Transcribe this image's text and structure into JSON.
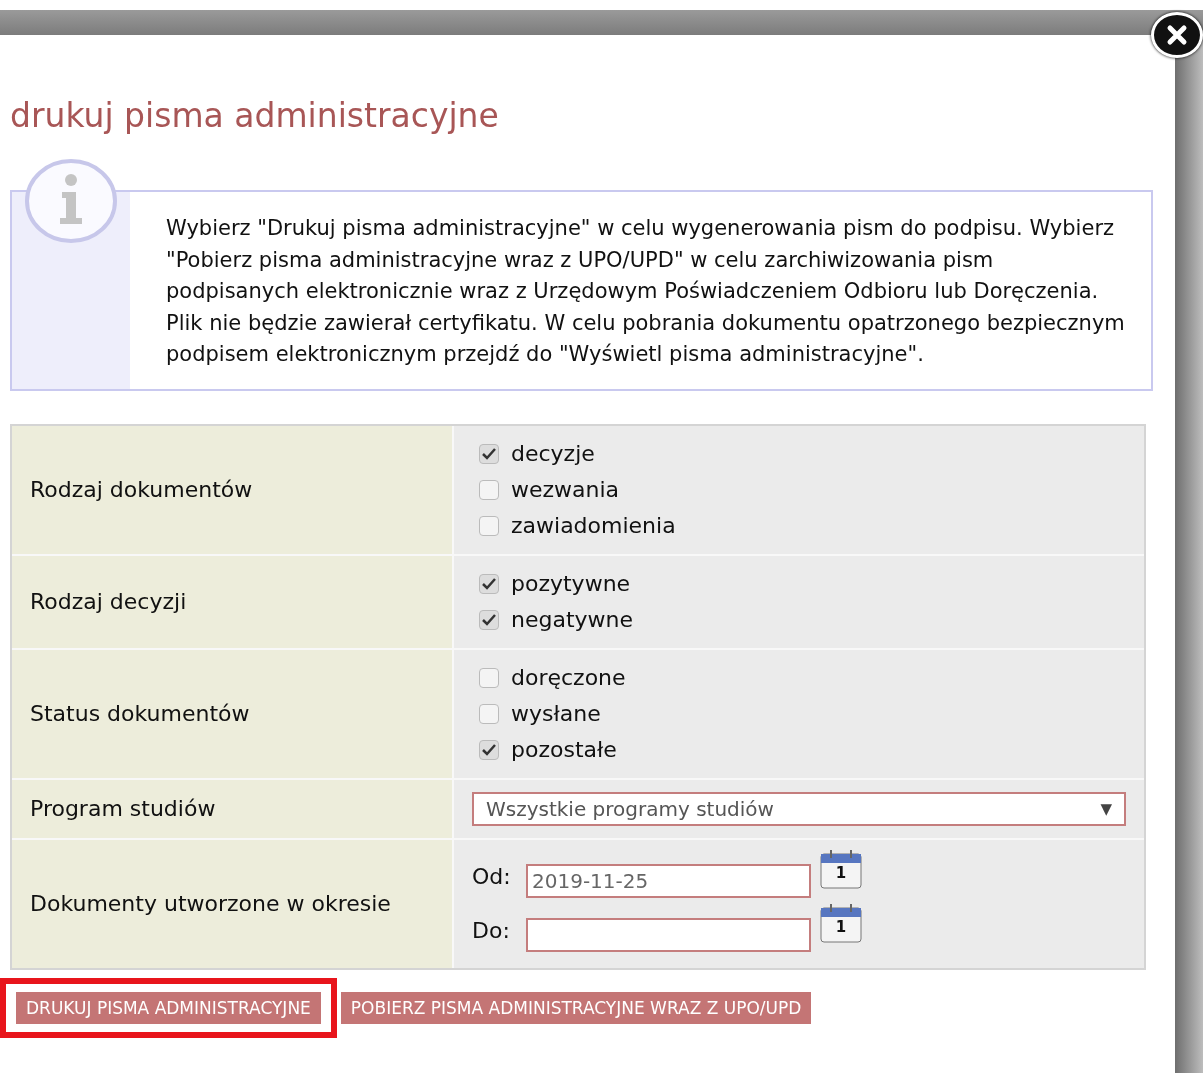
{
  "dialog": {
    "title": "drukuj pisma administracyjne",
    "info": "Wybierz \"Drukuj pisma administracyjne\" w celu wygenerowania pism do podpisu. Wybierz \"Pobierz pisma administracyjne wraz z UPO/UPD\" w celu zarchiwizowania pism podpisanych elektronicznie wraz z Urzędowym Poświadczeniem Odbioru lub Doręczenia. Plik nie będzie zawierał certyfikatu. W celu pobrania dokumentu opatrzonego bezpiecznym podpisem elektronicznym przejdź do \"Wyświetl pisma administracyjne\"."
  },
  "form": [
    {
      "kind": "checkboxes",
      "label": "Rodzaj dokumentów",
      "options": [
        {
          "label": "decyzje",
          "checked": true
        },
        {
          "label": "wezwania",
          "checked": false
        },
        {
          "label": "zawiadomienia",
          "checked": false
        }
      ]
    },
    {
      "kind": "checkboxes",
      "label": "Rodzaj decyzji",
      "options": [
        {
          "label": "pozytywne",
          "checked": true
        },
        {
          "label": "negatywne",
          "checked": true
        }
      ]
    },
    {
      "kind": "checkboxes",
      "label": "Status dokumentów",
      "options": [
        {
          "label": "doręczone",
          "checked": false
        },
        {
          "label": "wysłane",
          "checked": false
        },
        {
          "label": "pozostałe",
          "checked": true
        }
      ]
    },
    {
      "kind": "select",
      "label": "Program studiów",
      "value": "Wszystkie programy studiów",
      "arrow": "▼"
    },
    {
      "kind": "dates",
      "label": "Dokumenty utworzone w okresie",
      "fields": [
        {
          "label": "Od:",
          "value": "2019-11-25",
          "icon_text": "1"
        },
        {
          "label": "Do:",
          "icon_text": "1"
        }
      ]
    }
  ],
  "buttons": [
    {
      "label": "DRUKUJ PISMA ADMINISTRACYJNE",
      "highlighted": true
    },
    {
      "label": "POBIERZ PISMA ADMINISTRACYJNE WRAZ Z UPO/UPD",
      "highlighted": false
    }
  ]
}
